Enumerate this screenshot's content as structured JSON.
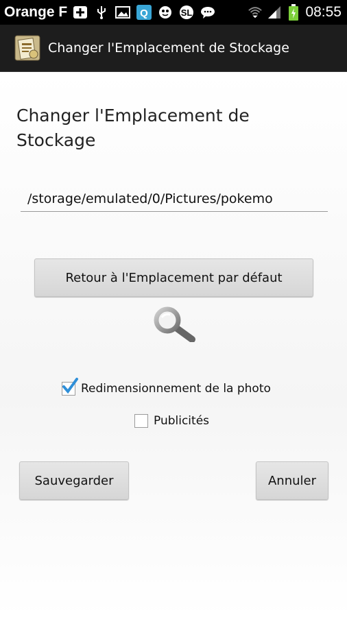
{
  "status_bar": {
    "carrier": "Orange F",
    "time": "08:55"
  },
  "action_bar": {
    "title": "Changer l'Emplacement de Stockage"
  },
  "main": {
    "heading": "Changer l'Emplacement de Stockage",
    "storage_path": "/storage/emulated/0/Pictures/pokemo",
    "reset_button": "Retour à l'Emplacement par défaut",
    "options": [
      {
        "label": "Redimensionnement de la photo",
        "checked": true
      },
      {
        "label": "Publicités",
        "checked": false
      }
    ],
    "save_button": "Sauvegarder",
    "cancel_button": "Annuler"
  },
  "colors": {
    "check_accent": "#2f8fd8",
    "battery": "#7ccf3a"
  }
}
